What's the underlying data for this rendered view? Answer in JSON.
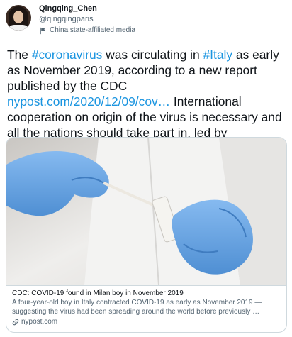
{
  "user": {
    "display_name": "Qingqing_Chen",
    "handle": "@qingqingparis",
    "affiliation": "China state-affiliated media"
  },
  "tweet": {
    "t1": "The ",
    "hashtag1": "#coronavirus",
    "t2": " was circulating in ",
    "hashtag2": "#Italy",
    "t3": " as early as November 2019, according to a new report published by the CDC ",
    "url": "nypost.com/2020/12/09/cov…",
    "t4": " International cooperation on origin of the virus is necessary and all the nations should take part in, led by scientists, not politicians."
  },
  "card": {
    "title": "CDC: COVID-19 found in Milan boy in November 2019",
    "description": "A four-year-old boy in Italy contracted COVID-19 as early as November 2019 — suggesting the virus had been spreading around the world before previously …",
    "domain": "nypost.com"
  },
  "colors": {
    "link": "#1b95e0",
    "text": "#0f1419",
    "secondary": "#536471",
    "border": "#cfd9de",
    "glove": "#6aa6e0"
  },
  "icons": {
    "affiliation": "state-media-flag-icon",
    "domain": "link-icon"
  }
}
